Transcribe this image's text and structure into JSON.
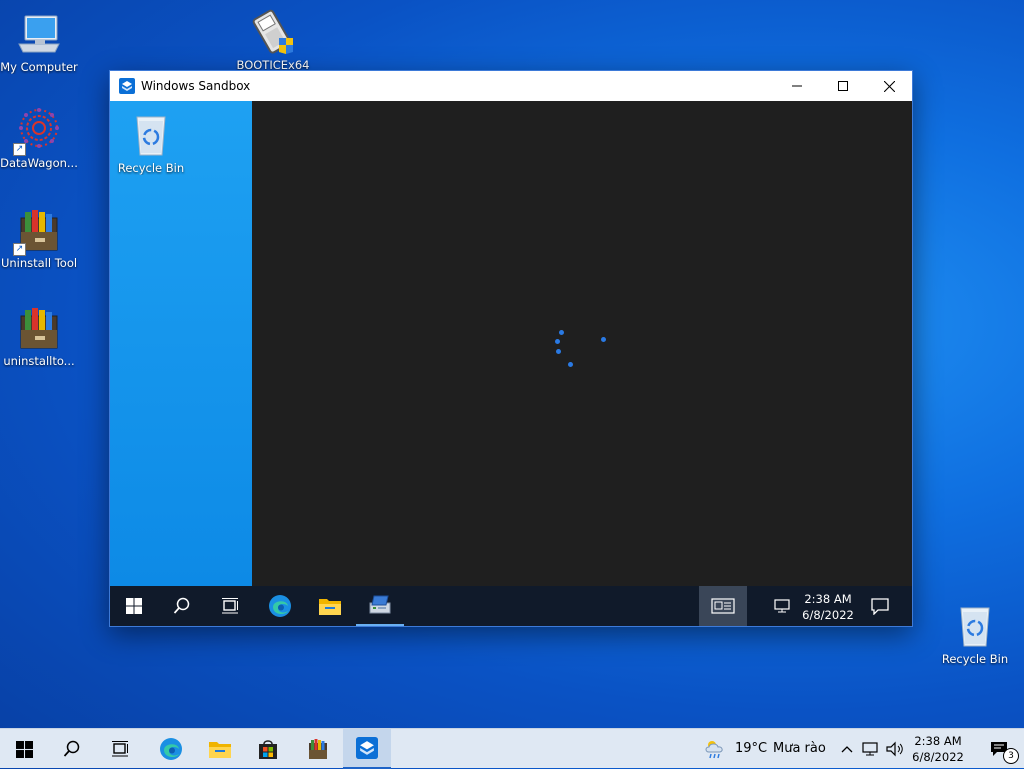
{
  "desktop": {
    "icons": [
      {
        "label": "My Computer",
        "icon": "computer-icon"
      },
      {
        "label": "BOOTICEx64",
        "icon": "bootice-icon"
      },
      {
        "label": "DataWagon...",
        "icon": "datawagon-icon"
      },
      {
        "label": "Uninstall Tool",
        "icon": "uninstall-tool-icon"
      },
      {
        "label": "uninstallto...",
        "icon": "uninstall-tool-icon"
      },
      {
        "label": "Recycle Bin",
        "icon": "recycle-bin-icon"
      }
    ]
  },
  "sandbox": {
    "title": "Windows Sandbox",
    "recycle_bin_label": "Recycle Bin",
    "clock_time": "2:38 AM",
    "clock_date": "6/8/2022",
    "accent": "#0d8ae6",
    "spinner_color": "#2a7ae4"
  },
  "taskbar": {
    "weather_temp": "19°C",
    "weather_text": "Mưa rào",
    "clock_time": "2:38 AM",
    "clock_date": "6/8/2022",
    "notification_count": "3",
    "icons": [
      "windows-start-icon",
      "search-icon",
      "task-view-icon",
      "edge-icon",
      "file-explorer-icon",
      "store-icon",
      "uninstall-tool-icon",
      "windows-sandbox-icon"
    ]
  }
}
